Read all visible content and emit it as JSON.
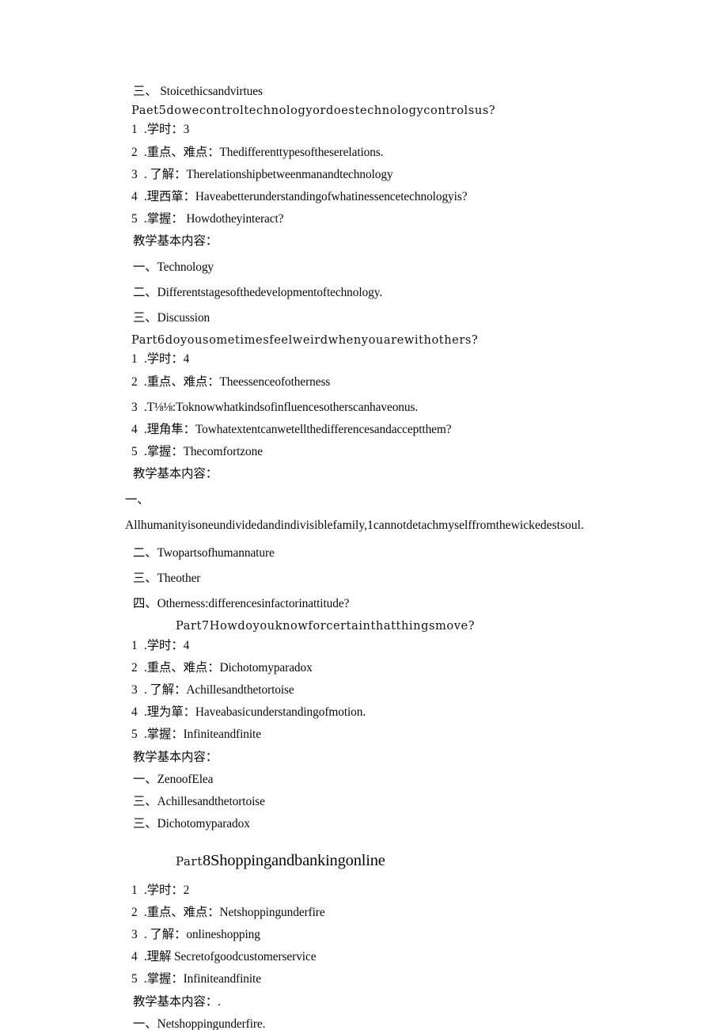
{
  "document": {
    "page_background": "#ffffff",
    "text_color": "#0a0a0a",
    "sections": {
      "part5": {
        "outline_heading": "三、 Stoicethicsandvirtues",
        "part_line": "Paet5dowecontroltechnologyordoestechnologycontrolsus?",
        "items": [
          {
            "num": "1",
            "text": ".学时：3"
          },
          {
            "num": "2",
            "text": ".重点、难点：Thedifferenttypesoftheserelations."
          },
          {
            "num": "3",
            "text": ". 了解：Therelationshipbetweenmanandtechnology"
          },
          {
            "num": "4",
            "text": ".理西箪：Haveabetterunderstandingofwhatinessencetechnologyis?"
          },
          {
            "num": "5",
            "text": ".掌握： Howdotheyinteract?"
          }
        ],
        "content_label": "教学基本内容：",
        "content_items": [
          "一、Technology",
          "二、Differentstagesofthedevelopmentoftechnology.",
          "三、Discussion"
        ]
      },
      "part6": {
        "part_line": "Part6doyousometimesfeelweirdwhenyouarewithothers?",
        "items": [
          {
            "num": "1",
            "text": ".学时：4"
          },
          {
            "num": "2",
            "text": ".重点、难点：Theessenceofotherness"
          },
          {
            "num": "3",
            "text": ".T⅛⅛:Toknowwhatkindsofinfluencesotherscanhaveonus."
          },
          {
            "num": "4",
            "text": ".理角隼：Towhatextentcanwetellthedifferencesandacceptthem?"
          },
          {
            "num": "5",
            "text": ".掌握：Thecomfortzone"
          }
        ],
        "content_label": "教学基本内容：",
        "content_marker_one": "一、",
        "content_paragraph": "Allhumanityisoneundividedandindivisiblefamily,1cannotdetachmyselffromthewickedestsoul.",
        "content_items": [
          "二、Twopartsofhumannature",
          "三、Theother",
          "四、Otherness:differencesinfactorinattitude?"
        ]
      },
      "part7": {
        "part_line": "Part7Howdoyouknowforcertainthatthingsmove?",
        "items": [
          {
            "num": "1",
            "text": ".学时：4"
          },
          {
            "num": "2",
            "text": ".重点、难点：Dichotomyparadox"
          },
          {
            "num": "3",
            "text": ". 了解：Achillesandthetortoise"
          },
          {
            "num": "4",
            "text": ".理为箪：Haveabasicunderstandingofmotion."
          },
          {
            "num": "5",
            "text": ".掌握：Infiniteandfinite"
          }
        ],
        "content_label": "教学基本内容：",
        "content_items": [
          "一、ZenoofElea",
          "三、Achillesandthetortoise",
          "三、Dichotomyparadox"
        ]
      },
      "part8": {
        "heading_prefix": "Part",
        "heading_text": "8Shoppingandbankingonline",
        "items": [
          {
            "num": "1",
            "text": ".学时：2"
          },
          {
            "num": "2",
            "text": ".重点、难点：Netshoppingunderfire"
          },
          {
            "num": "3",
            "text": ". 了解：onlineshopping"
          },
          {
            "num": "4",
            "text": ".理解 Secretofgoodcustomerservice"
          },
          {
            "num": "5",
            "text": ".掌握：Infiniteandfinite"
          }
        ],
        "content_label": "教学基本内容：.",
        "content_items": [
          "一、Netshoppingunderfire."
        ]
      }
    }
  }
}
